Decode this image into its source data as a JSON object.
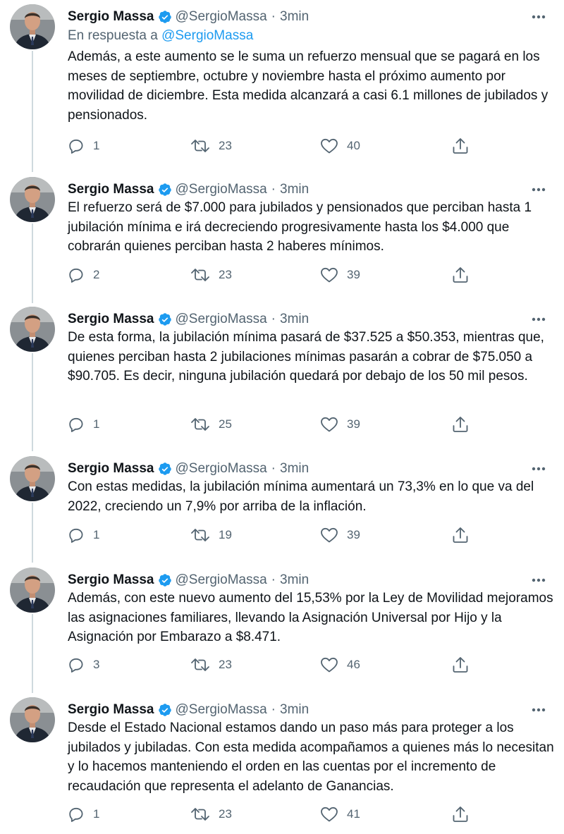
{
  "author": {
    "name": "Sergio Massa",
    "handle": "@SergioMassa",
    "separator": "·",
    "time": "3min"
  },
  "reply_to": {
    "prefix": "En respuesta a",
    "handle": "@SergioMassa"
  },
  "tweets": [
    {
      "text": "Además, a este aumento se le suma un refuerzo mensual que se pagará en los meses de septiembre, octubre y noviembre hasta el próximo aumento por movilidad de diciembre. Esta medida alcanzará a casi 6.1 millones de jubilados y pensionados.",
      "replies": "1",
      "retweets": "23",
      "likes": "40"
    },
    {
      "text": "El refuerzo será de $7.000 para jubilados y pensionados que perciban hasta 1 jubilación mínima e irá decreciendo progresivamente hasta los $4.000 que cobrarán quienes perciban hasta 2 haberes mínimos.",
      "replies": "2",
      "retweets": "23",
      "likes": "39"
    },
    {
      "text": "De esta forma, la jubilación mínima pasará de $37.525 a $50.353, mientras que, quienes perciban hasta 2 jubilaciones mínimas pasarán a cobrar de $75.050 a $90.705. Es decir, ninguna jubilación quedará por debajo de los 50 mil pesos.",
      "replies": "1",
      "retweets": "25",
      "likes": "39"
    },
    {
      "text": "Con estas medidas, la jubilación mínima aumentará un 73,3% en lo que va del 2022, creciendo un 7,9% por arriba de la inflación.",
      "replies": "1",
      "retweets": "19",
      "likes": "39"
    },
    {
      "text": "Además, con este nuevo aumento del 15,53% por la Ley de Movilidad mejoramos las asignaciones familiares, llevando la Asignación Universal por Hijo y la Asignación por Embarazo a $8.471.",
      "replies": "3",
      "retweets": "23",
      "likes": "46"
    },
    {
      "text": "Desde el Estado Nacional estamos dando un paso más para proteger a los jubilados y jubiladas. Con esta medida acompañamos a quienes más lo necesitan y lo hacemos manteniendo el orden en las cuentas por el incremento de recaudación que representa el adelanto de Ganancias.",
      "replies": "1",
      "retweets": "23",
      "likes": "41"
    }
  ],
  "colors": {
    "text": "#0f1419",
    "secondary": "#536471",
    "link": "#1d9bf0",
    "verified": "#1d9bf0",
    "thread_line": "#cfd9de"
  },
  "icons": {
    "verified": "verified-badge-icon",
    "more": "more-options-icon",
    "reply": "reply-icon",
    "retweet": "retweet-icon",
    "like": "heart-icon",
    "share": "share-icon"
  }
}
